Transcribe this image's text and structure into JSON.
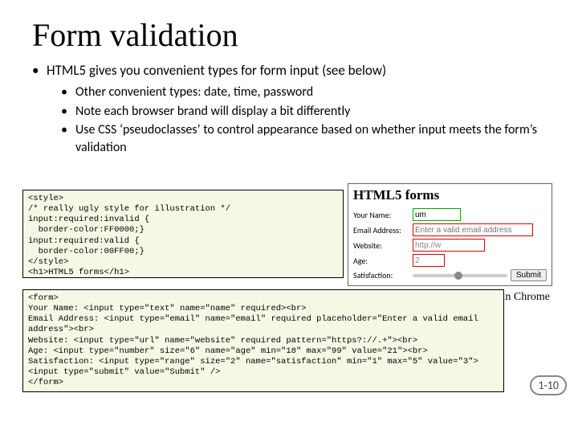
{
  "title": "Form validation",
  "bullet_main": "HTML5 gives you convenient types for form input (see below)",
  "sub": [
    "Other convenient types: date, time, password",
    "Note each browser brand will display a bit differently",
    "Use CSS ‘pseudoclasses’ to control appearance based on whether input meets the form’s validation"
  ],
  "code_style": "<style>\n/* really ugly style for illustration */\ninput:required:invalid {\n  border-color:FF0000;}\ninput:required:valid {\n  border-color:00FF00;}\n</style>\n<h1>HTML5 forms</h1>",
  "code_form": "<form>\nYour Name: <input type=\"text\" name=\"name\" required><br>\nEmail Address: <input type=\"email\" name=\"email\" required placeholder=\"Enter a valid email address\"><br>\nWebsite: <input type=\"url\" name=\"website\" required pattern=\"https?://.+\"><br>\nAge: <input type=\"number\" size=\"6\" name=\"age\" min=\"18\" max=\"99\" value=\"21\"><br>\nSatisfaction: <input type=\"range\" size=\"2\" name=\"satisfaction\" min=\"1\" max=\"5\" value=\"3\">\n<input type=\"submit\" value=\"Submit\" />\n</form>",
  "chrome": {
    "heading": "HTML5 forms",
    "name_label": "Your Name:",
    "name_value": "um",
    "email_label": "Email Address:",
    "email_placeholder": "Enter a valid email address",
    "website_label": "Website:",
    "website_value": "http://w",
    "age_label": "Age:",
    "age_value": "2",
    "sat_label": "Satisfaction:",
    "submit": "Submit"
  },
  "caption": "Appearance in Chrome",
  "pagenum": "1-10"
}
